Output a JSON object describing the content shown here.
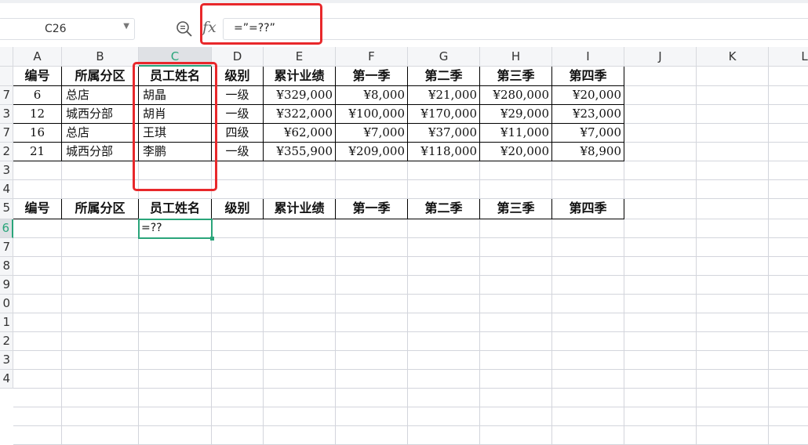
{
  "formula_bar": {
    "name_box": "C26",
    "formula": "=”=??”",
    "fx_label": "fx"
  },
  "columns": [
    "A",
    "B",
    "C",
    "D",
    "E",
    "F",
    "G",
    "H",
    "I",
    "J",
    "K",
    "L"
  ],
  "row_numbers": [
    "7",
    "3",
    "7",
    "2",
    "3",
    "4",
    "5",
    "6",
    "7",
    "8",
    "9",
    "0",
    "1",
    "2",
    "3",
    "4"
  ],
  "table1": {
    "headers": [
      "编号",
      "所属分区",
      "员工姓名",
      "级别",
      "累计业绩",
      "第一季",
      "第二季",
      "第三季",
      "第四季"
    ],
    "rows": [
      [
        "6",
        "总店",
        "胡晶",
        "一级",
        "¥329,000",
        "¥8,000",
        "¥21,000",
        "¥280,000",
        "¥20,000"
      ],
      [
        "12",
        "城西分部",
        "胡肖",
        "一级",
        "¥322,000",
        "¥100,000",
        "¥170,000",
        "¥29,000",
        "¥23,000"
      ],
      [
        "16",
        "总店",
        "王琪",
        "四级",
        "¥62,000",
        "¥7,000",
        "¥37,000",
        "¥11,000",
        "¥7,000"
      ],
      [
        "21",
        "城西分部",
        "李鹏",
        "一级",
        "¥355,900",
        "¥209,000",
        "¥118,000",
        "¥20,000",
        "¥8,900"
      ]
    ]
  },
  "table2": {
    "headers": [
      "编号",
      "所属分区",
      "员工姓名",
      "级别",
      "累计业绩",
      "第一季",
      "第二季",
      "第三季",
      "第四季"
    ],
    "active_cell_value": "=??"
  },
  "colors": {
    "accent": "#2aa57a",
    "highlight": "#e8282b"
  }
}
